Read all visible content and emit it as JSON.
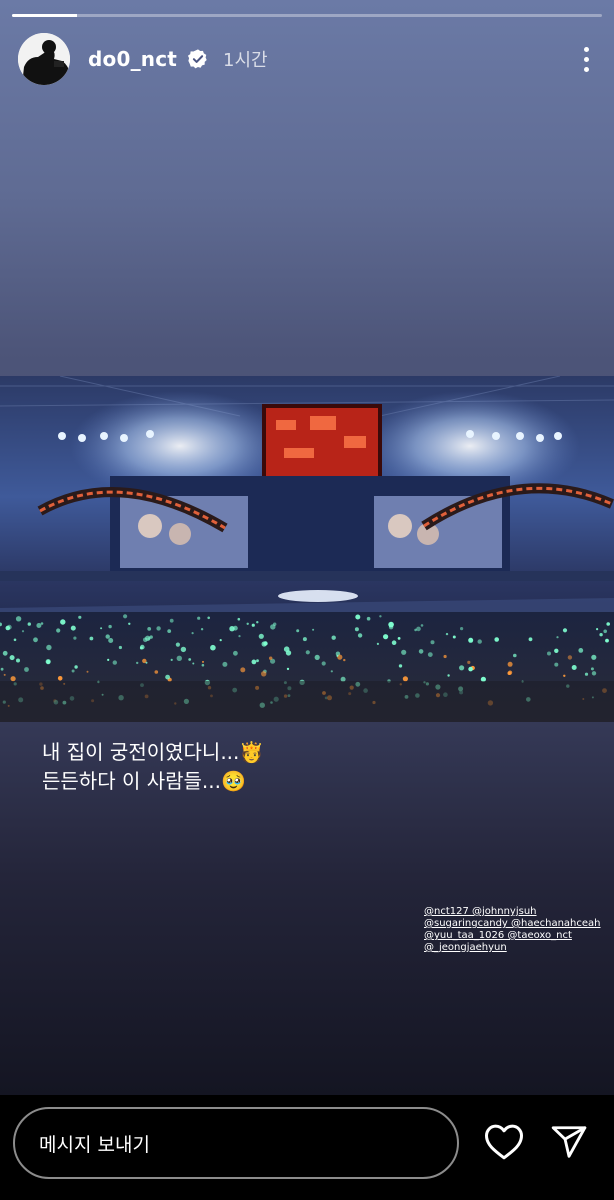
{
  "story": {
    "progress_fraction": 0.11,
    "header": {
      "username": "do0_nct",
      "timestamp": "1시간",
      "icons": [
        "avatar",
        "verified-badge-icon",
        "more-options-icon"
      ]
    },
    "caption": {
      "line1": "내 집이 궁전이였다니...🫅",
      "line2": "든든하다 이 사람들...🥹"
    },
    "mentions": [
      "@nct127 @johnnyjsuh",
      "@sugaringcandy @haechanahceah",
      "@yuu_taa_1026 @taeoxo_nct",
      "@_jeongjaehyun"
    ],
    "colors": {
      "top": "#6b7aa6",
      "bottom": "#141522",
      "lightstick": "#7fffd0"
    }
  },
  "footer": {
    "message_placeholder": "메시지 보내기",
    "icons": [
      "heart-icon",
      "send-icon"
    ]
  }
}
